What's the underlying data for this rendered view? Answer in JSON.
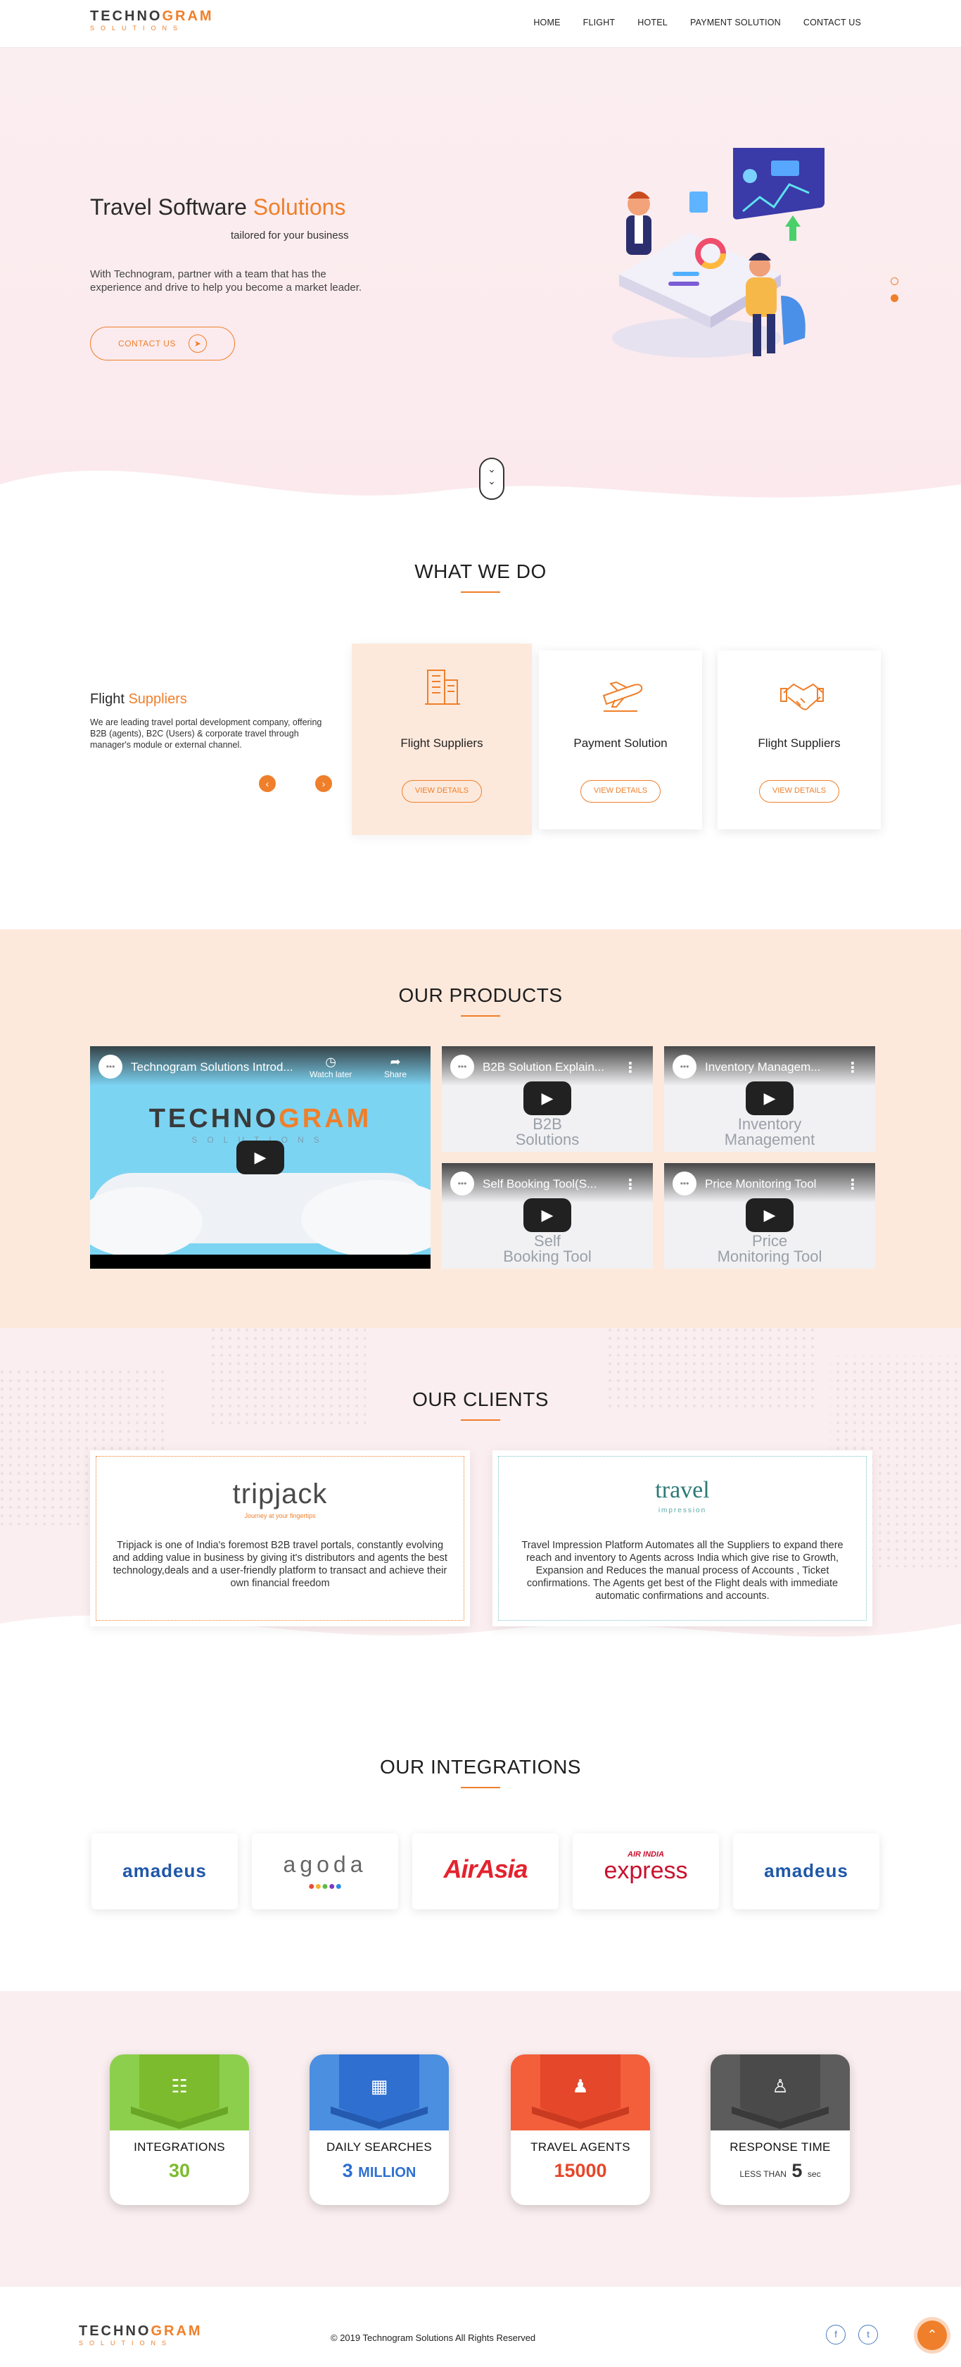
{
  "brand": {
    "logo_part1": "TECHNO",
    "logo_part2": "GRAM",
    "logo_sub": "SOLUTIONS"
  },
  "nav": {
    "items": [
      "HOME",
      "FLIGHT",
      "HOTEL",
      "PAYMENT SOLUTION",
      "CONTACT US"
    ]
  },
  "hero": {
    "title_part1": "Travel Software",
    "title_part2": "Solutions",
    "tagline": "tailored for your business",
    "text": "With Technogram, partner with a team that has the experience and drive to help you become a market leader.",
    "cta": "CONTACT US"
  },
  "what_we_do": {
    "title": "WHAT WE DO",
    "heading_part1": "Flight",
    "heading_part2": "Suppliers",
    "text": "We are leading travel portal development company, offering B2B (agents), B2C (Users) & corporate travel through manager's module or external channel.",
    "cards": [
      {
        "name": "Flight Suppliers",
        "button": "VIEW DETAILS",
        "icon": "building-icon"
      },
      {
        "name": "Payment Solution",
        "button": "VIEW DETAILS",
        "icon": "plane-icon"
      },
      {
        "name": "Flight Suppliers",
        "button": "VIEW DETAILS",
        "icon": "handshake-icon"
      }
    ]
  },
  "products": {
    "title": "OUR PRODUCTS",
    "main_video": {
      "title": "Technogram Solutions Introd...",
      "watch_later": "Watch later",
      "share": "Share",
      "brand_part1": "TECHNO",
      "brand_part2": "GRAM",
      "brand_sub": "SOLUTIONS"
    },
    "videos": [
      {
        "title": "B2B Solution Explain...",
        "big_line1": "B2B",
        "big_line2": "Solutions"
      },
      {
        "title": "Inventory Managem...",
        "big_line1": "Inventory",
        "big_line2": "Management"
      },
      {
        "title": "Self Booking Tool(S...",
        "big_line1": "Self",
        "big_line2": "Booking Tool"
      },
      {
        "title": "Price Monitoring Tool",
        "big_line1": "Price",
        "big_line2": "Monitoring Tool"
      }
    ]
  },
  "clients": {
    "title": "OUR CLIENTS",
    "items": [
      {
        "logo": "tripjack",
        "logo_sub": "Journey at your fingertips",
        "desc": "Tripjack is one of India's foremost B2B travel portals, constantly evolving and adding value in business by giving it's distributors and agents the best technology,deals and a user-friendly platform to transact and achieve their own financial freedom"
      },
      {
        "logo": "travel",
        "logo_sub": "impression",
        "desc": "Travel Impression Platform Automates all the Suppliers to expand there reach and inventory to Agents across India which give rise to Growth, Expansion and Reduces the manual process of Accounts , Ticket confirmations. The Agents get best of the Flight deals with immediate automatic confirmations and accounts."
      }
    ]
  },
  "integrations": {
    "title": "OUR INTEGRATIONS",
    "partners": [
      "amadeus",
      "agoda",
      "AirAsia",
      "AIR INDIA",
      "express",
      "amadeus"
    ]
  },
  "stats": [
    {
      "label": "INTEGRATIONS",
      "value": "30",
      "color": "#7cbb2e",
      "head": "#8ccf4d",
      "icon": "monitor-icon"
    },
    {
      "label": "DAILY SEARCHES",
      "value": "3",
      "unit": "MILLION",
      "color": "#2f6fd0",
      "head": "#4a8fe0",
      "icon": "network-icon"
    },
    {
      "label": "TRAVEL AGENTS",
      "value": "15000",
      "color": "#e5472a",
      "head": "#f25f3a",
      "icon": "agent-icon"
    },
    {
      "label": "RESPONSE TIME",
      "value_prefix": "LESS THAN",
      "value": "5",
      "unit": "sec",
      "color": "#333333",
      "head": "#5c5c5c",
      "icon": "team-icon"
    }
  ],
  "footer": {
    "copyright": "© 2019 Technogram Solutions All Rights Reserved",
    "social": [
      "facebook-icon",
      "twitter-icon"
    ]
  }
}
